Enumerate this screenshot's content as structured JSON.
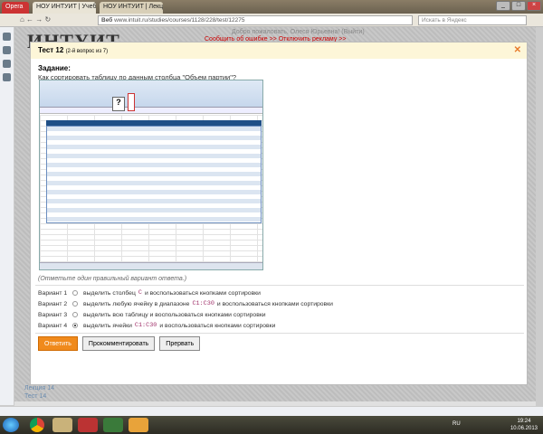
{
  "browser": {
    "tabs": [
      "Opera",
      "НОУ ИНТУИТ | Учебн...",
      "НОУ ИНТУИТ | Лекци..."
    ],
    "url_prefix": "Веб",
    "url": "www.intuit.ru/studies/courses/1128/228/test/12275",
    "search_placeholder": "Искать в Яндекс"
  },
  "site": {
    "logo": "ИНТУИТ",
    "welcome": "Добро пожаловать, Олеся Юрьевна! (Выйти)",
    "links": "Сообщить об ошибке >> Отключить рекламу >>"
  },
  "modal": {
    "title": "Тест 12",
    "subtitle": "(2-й вопрос из 7)",
    "task_label": "Задание:",
    "question": "Как сортировать таблицу по данным столбца \"Объем партии\"?",
    "hint": "(Отметьте один правильный вариант ответа.)",
    "options": [
      {
        "label": "Вариант 1",
        "before": "выделить столбец",
        "code": "C",
        "after": "и воспользоваться кнопками сортировки",
        "selected": false
      },
      {
        "label": "Вариант 2",
        "before": "выделить любую ячейку в диапазоне",
        "code": "C1:C30",
        "after": "и воспользоваться кнопками сортировки",
        "selected": false
      },
      {
        "label": "Вариант 3",
        "before": "выделить всю таблицу и воспользоваться кнопками сортировки",
        "code": "",
        "after": "",
        "selected": false
      },
      {
        "label": "Вариант 4",
        "before": "выделить ячейки",
        "code": "C1:C30",
        "after": "и воспользоваться кнопками сортировки",
        "selected": true
      }
    ],
    "buttons": {
      "answer": "Ответить",
      "comment": "Прокомментировать",
      "abort": "Прервать"
    }
  },
  "below_links": [
    "Лекция 14",
    "Тест 14"
  ],
  "taskbar": {
    "lang": "RU",
    "time": "19:24",
    "date": "10.06.2013"
  }
}
